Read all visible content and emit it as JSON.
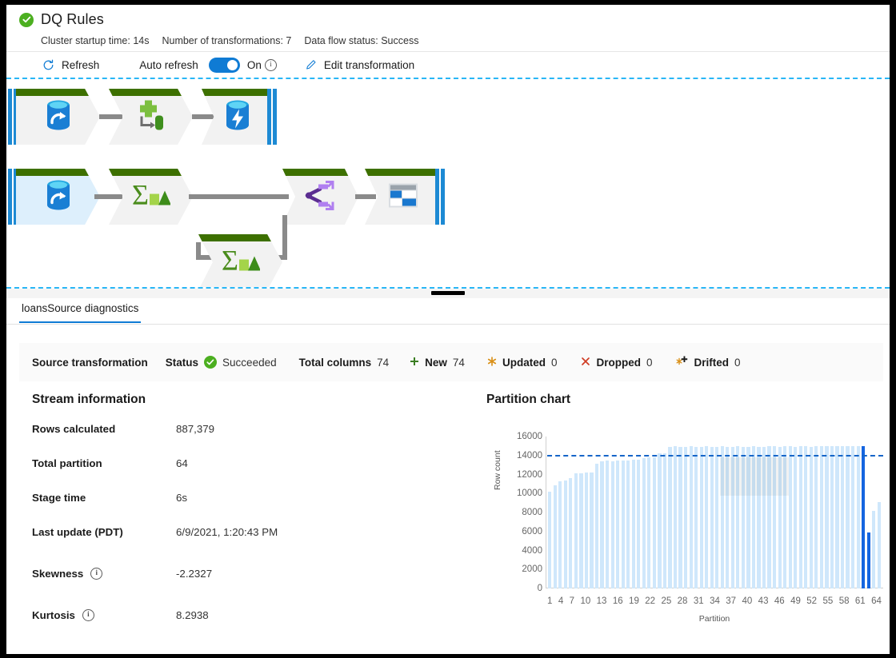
{
  "header": {
    "status_icon": "success-check-icon",
    "title": "DQ Rules",
    "meta": [
      "Cluster startup time: 14s",
      "Number of transformations: 7",
      "Data flow status: Success"
    ]
  },
  "toolbar": {
    "refresh_icon": "refresh-icon",
    "refresh_label": "Refresh",
    "auto_refresh_label": "Auto refresh",
    "toggle_state": "On",
    "toggle_on": true,
    "info_icon": "info-icon",
    "edit_icon": "pencil-icon",
    "edit_label": "Edit transformation",
    "accent_color": "#0f7bd4"
  },
  "dataflow": {
    "row1": [
      {
        "icon": "azure-source-database-icon",
        "selected": false
      },
      {
        "icon": "derived-column-icon",
        "selected": false
      },
      {
        "icon": "azure-sink-database-icon",
        "selected": false
      }
    ],
    "row2": [
      {
        "icon": "azure-source-database-icon",
        "selected": true
      },
      {
        "icon": "aggregate-sigma-icon",
        "selected": false
      },
      {
        "icon": "conditional-split-icon",
        "selected": false
      },
      {
        "icon": "window-sink-icon",
        "selected": false
      }
    ],
    "row3": [
      {
        "icon": "aggregate-sigma-icon",
        "selected": false
      }
    ]
  },
  "splitter": {
    "grip": "drag-handle"
  },
  "tab": {
    "label": "loansSource diagnostics"
  },
  "summary": {
    "transformation_type": "Source transformation",
    "status_label": "Status",
    "status_icon": "success-check-icon",
    "status_value": "Succeeded",
    "total_columns_label": "Total columns",
    "total_columns_value": "74",
    "new_icon": "plus-icon",
    "new_label": "New",
    "new_value": "74",
    "updated_icon": "asterisk-icon",
    "updated_label": "Updated",
    "updated_value": "0",
    "dropped_icon": "cross-icon",
    "dropped_label": "Dropped",
    "dropped_value": "0",
    "drifted_icon": "drifted-icon",
    "drifted_label": "Drifted",
    "drifted_value": "0"
  },
  "stream_information": {
    "title": "Stream information",
    "rows": [
      {
        "label": "Rows calculated",
        "value": "887,379",
        "info": false
      },
      {
        "label": "Total partition",
        "value": "64",
        "info": false
      },
      {
        "label": "Stage time",
        "value": "6s",
        "info": false
      },
      {
        "label": "Last update (PDT)",
        "value": "6/9/2021, 1:20:43 PM",
        "info": false
      },
      {
        "label": "Skewness",
        "value": "-2.2327",
        "info": true
      },
      {
        "label": "Kurtosis",
        "value": "8.2938",
        "info": true
      }
    ]
  },
  "chart_data": {
    "type": "bar",
    "title": "Partition chart",
    "xlabel": "Partition",
    "ylabel": "Row count",
    "ylim": [
      0,
      16000
    ],
    "yticks": [
      16000,
      14000,
      12000,
      10000,
      8000,
      6000,
      4000,
      2000,
      0
    ],
    "xticks": [
      1,
      4,
      7,
      10,
      13,
      16,
      19,
      22,
      25,
      28,
      31,
      34,
      37,
      40,
      43,
      46,
      49,
      52,
      55,
      58,
      61,
      64
    ],
    "grid": false,
    "legend": false,
    "average_line": 13865,
    "bar_color": "#cfe7fb",
    "highlight_color": "#1565e0",
    "highlighted_partitions": [
      61,
      62
    ],
    "categories": [
      1,
      2,
      3,
      4,
      5,
      6,
      7,
      8,
      9,
      10,
      11,
      12,
      13,
      14,
      15,
      16,
      17,
      18,
      19,
      20,
      21,
      22,
      23,
      24,
      25,
      26,
      27,
      28,
      29,
      30,
      31,
      32,
      33,
      34,
      35,
      36,
      37,
      38,
      39,
      40,
      41,
      42,
      43,
      44,
      45,
      46,
      47,
      48,
      49,
      50,
      51,
      52,
      53,
      54,
      55,
      56,
      57,
      58,
      59,
      60,
      61,
      62,
      63,
      64
    ],
    "values": [
      10200,
      10900,
      11300,
      11400,
      11600,
      12100,
      12150,
      12200,
      12250,
      13150,
      13400,
      13450,
      13400,
      13450,
      13450,
      13500,
      13600,
      13600,
      13700,
      13800,
      13850,
      14200,
      14250,
      14900,
      14950,
      14900,
      14900,
      14950,
      14900,
      14900,
      14950,
      14900,
      14900,
      14950,
      14900,
      14900,
      14950,
      14900,
      14900,
      14950,
      14900,
      14900,
      14950,
      14950,
      14900,
      14950,
      14950,
      14900,
      14950,
      14950,
      14900,
      14950,
      14950,
      14950,
      14950,
      14950,
      14950,
      14950,
      14950,
      14950,
      15000,
      5900,
      8200,
      9100
    ]
  }
}
